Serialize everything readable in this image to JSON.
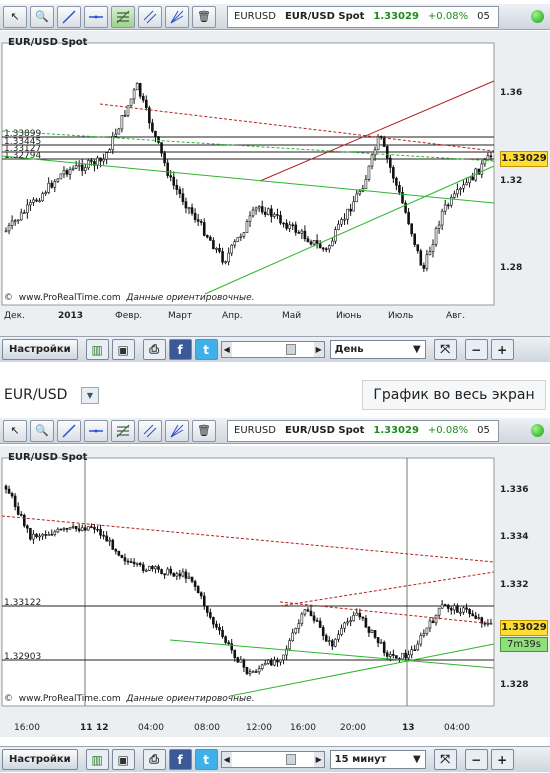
{
  "quote": {
    "instrument": "EURUSD",
    "pair": "EUR/USD Spot",
    "price": "1.33029",
    "change": "+0.08%",
    "time_fragment": "05"
  },
  "chart1": {
    "title": "EUR/USD Spot",
    "y_ticks": [
      "1.36",
      "1.32",
      "1.28"
    ],
    "level_labels": [
      "1.33899",
      "1.33445",
      "1.33127",
      "1.32794"
    ],
    "x_ticks": [
      "Дек.",
      "2013",
      "Февр.",
      "Март",
      "Апр.",
      "Май",
      "Июнь",
      "Июль",
      "Авг."
    ],
    "price_box": "1.33029",
    "credit_url": "www.ProRealTime.com",
    "credit_note": "Данные ориентировочные."
  },
  "bottombar1": {
    "settings_label": "Настройки",
    "period": "День"
  },
  "symbol_bar": {
    "symbol": "EUR/USD",
    "fullscreen_label": "График во весь экран"
  },
  "chart2": {
    "title": "EUR/USD Spot",
    "y_ticks": [
      "1.336",
      "1.334",
      "1.332",
      "1.328"
    ],
    "level_labels": [
      "1.33122",
      "1.32903"
    ],
    "x_ticks": [
      "16:00",
      "11",
      "12",
      "04:00",
      "08:00",
      "12:00",
      "16:00",
      "20:00",
      "13",
      "04:00"
    ],
    "price_box": "1.33029",
    "timer": "7m39s",
    "credit_url": "www.ProRealTime.com",
    "credit_note": "Данные ориентировочные."
  },
  "bottombar2": {
    "settings_label": "Настройки",
    "period": "15 минут"
  },
  "colors": {
    "accent_green": "#1c8c1c",
    "price_box": "#ffdd33",
    "timer": "#8fe07a"
  }
}
